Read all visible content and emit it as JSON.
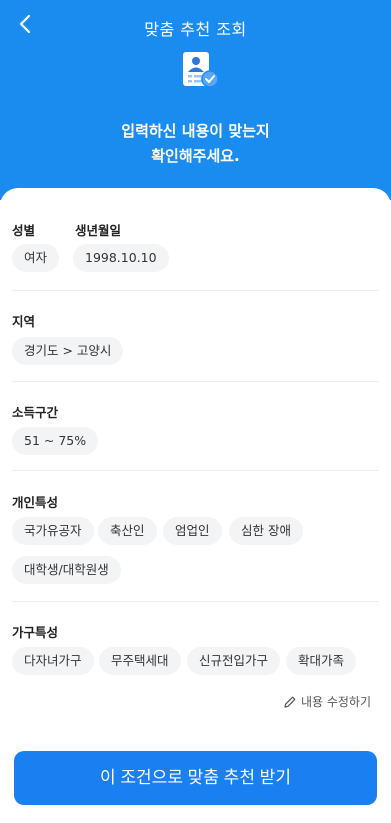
{
  "header": {
    "title": "맞춤 추천 조회"
  },
  "hero": {
    "line1_emphasis": "입력하신 내용",
    "line1_rest": "이 맞는지",
    "line2": "확인해주세요."
  },
  "profile": {
    "gender_label": "성별",
    "gender_value": "여자",
    "birth_label": "생년월일",
    "birth_value": "1998.10.10"
  },
  "region": {
    "label": "지역",
    "value": "경기도 > 고양시"
  },
  "income": {
    "label": "소득구간",
    "value": "51 ~ 75%"
  },
  "personal": {
    "label": "개인특성",
    "tags": [
      "국가유공자",
      "축산인",
      "엄업인",
      "심한 장애",
      "대학생/대학원생"
    ]
  },
  "household": {
    "label": "가구특성",
    "tags": [
      "다자녀가구",
      "무주택세대",
      "신규전입가구",
      "확대가족"
    ]
  },
  "edit_link": {
    "label": "내용 수정하기"
  },
  "cta": {
    "label": "이 조건으로 맞춤 추천 받기"
  },
  "colors": {
    "primary": "#1a8cf0",
    "button": "#1a7ff0",
    "chip_bg": "#f2f4f6"
  }
}
